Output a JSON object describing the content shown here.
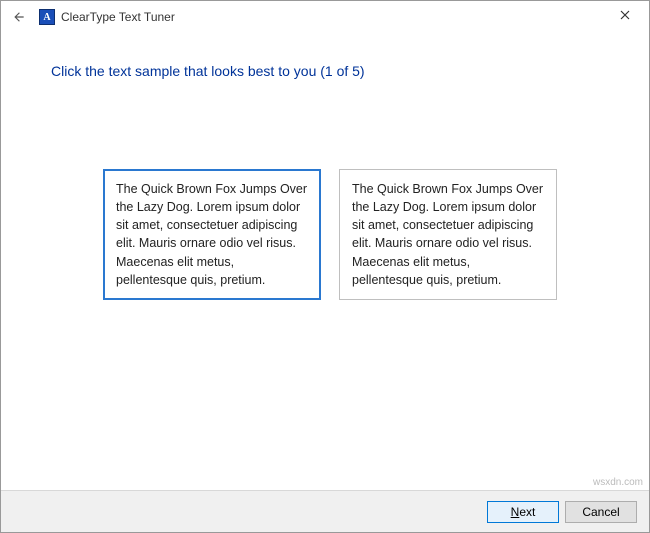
{
  "window": {
    "title": "ClearType Text Tuner",
    "app_icon_letter": "A"
  },
  "heading": "Click the text sample that looks best to you (1 of 5)",
  "samples": [
    {
      "text": "The Quick Brown Fox Jumps Over the Lazy Dog. Lorem ipsum dolor sit amet, consectetuer adipiscing elit. Mauris ornare odio vel risus. Maecenas elit metus, pellentesque quis, pretium.",
      "selected": true
    },
    {
      "text": "The Quick Brown Fox Jumps Over the Lazy Dog. Lorem ipsum dolor sit amet, consectetuer adipiscing elit. Mauris ornare odio vel risus. Maecenas elit metus, pellentesque quis, pretium.",
      "selected": false
    }
  ],
  "footer": {
    "next_accel": "N",
    "next_rest": "ext",
    "cancel_label": "Cancel"
  },
  "watermark": "wsxdn.com"
}
